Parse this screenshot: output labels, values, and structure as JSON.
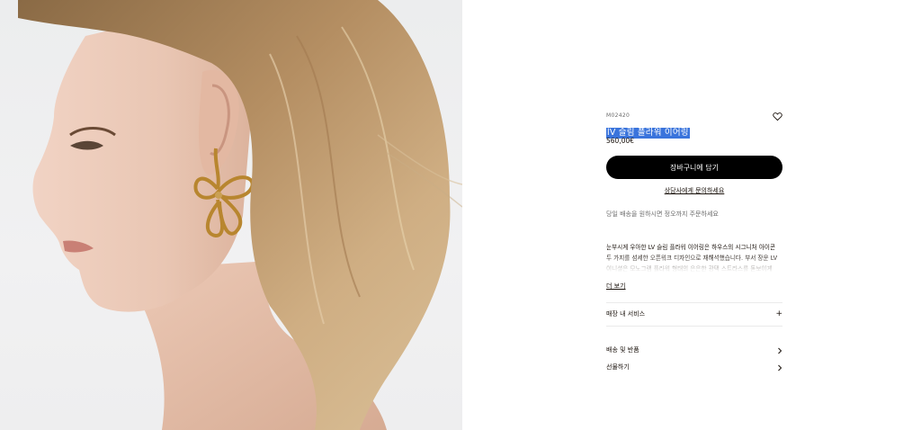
{
  "product": {
    "sku": "M02420",
    "title": "lV 슬림 플라워 이어링",
    "price": "560,00€"
  },
  "actions": {
    "add_to_cart": "장바구니에 담기",
    "contact_advisor": "상담사에게 문의하세요",
    "same_day": "당일 배송을 원하시면 정오까지 주문하세요",
    "read_more": "더 보기"
  },
  "description": "눈부시게 우아한 LV 슬림 플라워 이어링은 하우스의 시그니처 아이콘 두 가지를 섬세한 오픈워크 디자인으로 재해석했습니다. 부서 장운 LV 이니셜은 모노그램 플라워 형태의 은은한 광택 스트라스를 돋보이게 합니다.",
  "sections": [
    {
      "label": "매장 내 서비스",
      "icon": "plus-icon"
    },
    {
      "label": "배송 및 반품",
      "icon": "chevron-right-icon"
    },
    {
      "label": "선물하기",
      "icon": "chevron-right-icon"
    }
  ],
  "colors": {
    "accent_selection": "#3a74dc",
    "button_bg": "#000000",
    "text": "#19110b"
  }
}
